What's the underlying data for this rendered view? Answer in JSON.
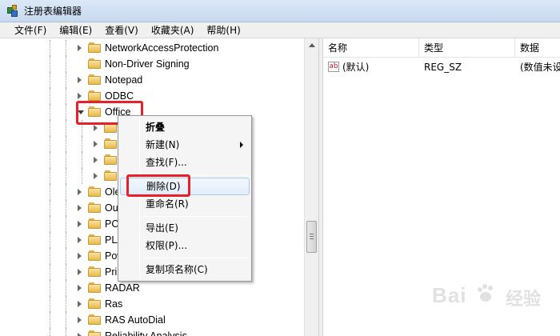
{
  "window": {
    "title": "注册表编辑器"
  },
  "menubar": {
    "items": [
      "文件(F)",
      "编辑(E)",
      "查看(V)",
      "收藏夹(A)",
      "帮助(H)"
    ]
  },
  "tree": {
    "nodes": [
      {
        "label": "NetworkAccessProtection",
        "expander": "closed"
      },
      {
        "label": "Non-Driver Signing",
        "expander": "none"
      },
      {
        "label": "Notepad",
        "expander": "closed"
      },
      {
        "label": "ODBC",
        "expander": "closed"
      },
      {
        "label": "Office",
        "expander": "open"
      },
      {
        "label": "",
        "expander": "closed"
      },
      {
        "label": "",
        "expander": "closed"
      },
      {
        "label": "",
        "expander": "closed"
      },
      {
        "label": "",
        "expander": "closed"
      },
      {
        "label": "Ole",
        "expander": "closed"
      },
      {
        "label": "Ou",
        "expander": "closed"
      },
      {
        "label": "PC",
        "expander": "closed"
      },
      {
        "label": "PLA",
        "expander": "closed"
      },
      {
        "label": "Pow",
        "expander": "closed"
      },
      {
        "label": "Pri",
        "expander": "closed"
      },
      {
        "label": "RADAR",
        "expander": "closed"
      },
      {
        "label": "Ras",
        "expander": "closed"
      },
      {
        "label": "RAS AutoDial",
        "expander": "closed"
      },
      {
        "label": "Reliability Analysis",
        "expander": "closed"
      }
    ]
  },
  "list": {
    "columns": [
      "名称",
      "类型",
      "数据"
    ],
    "rows": [
      {
        "icon": "ab",
        "name": "(默认)",
        "type": "REG_SZ",
        "data": "(数值未设"
      }
    ]
  },
  "context_menu": {
    "items": {
      "collapse": "折叠",
      "new": "新建(N)",
      "find": "查找(F)...",
      "delete": "删除(D)",
      "rename": "重命名(R)",
      "export": "导出(E)",
      "permissions": "权限(P)...",
      "copy_key_name": "复制项名称(C)"
    }
  },
  "watermark": {
    "text": "Bai",
    "suffix": "经验"
  },
  "colors": {
    "highlight": "#e8202a",
    "titlebar": "#c7d9ef"
  }
}
